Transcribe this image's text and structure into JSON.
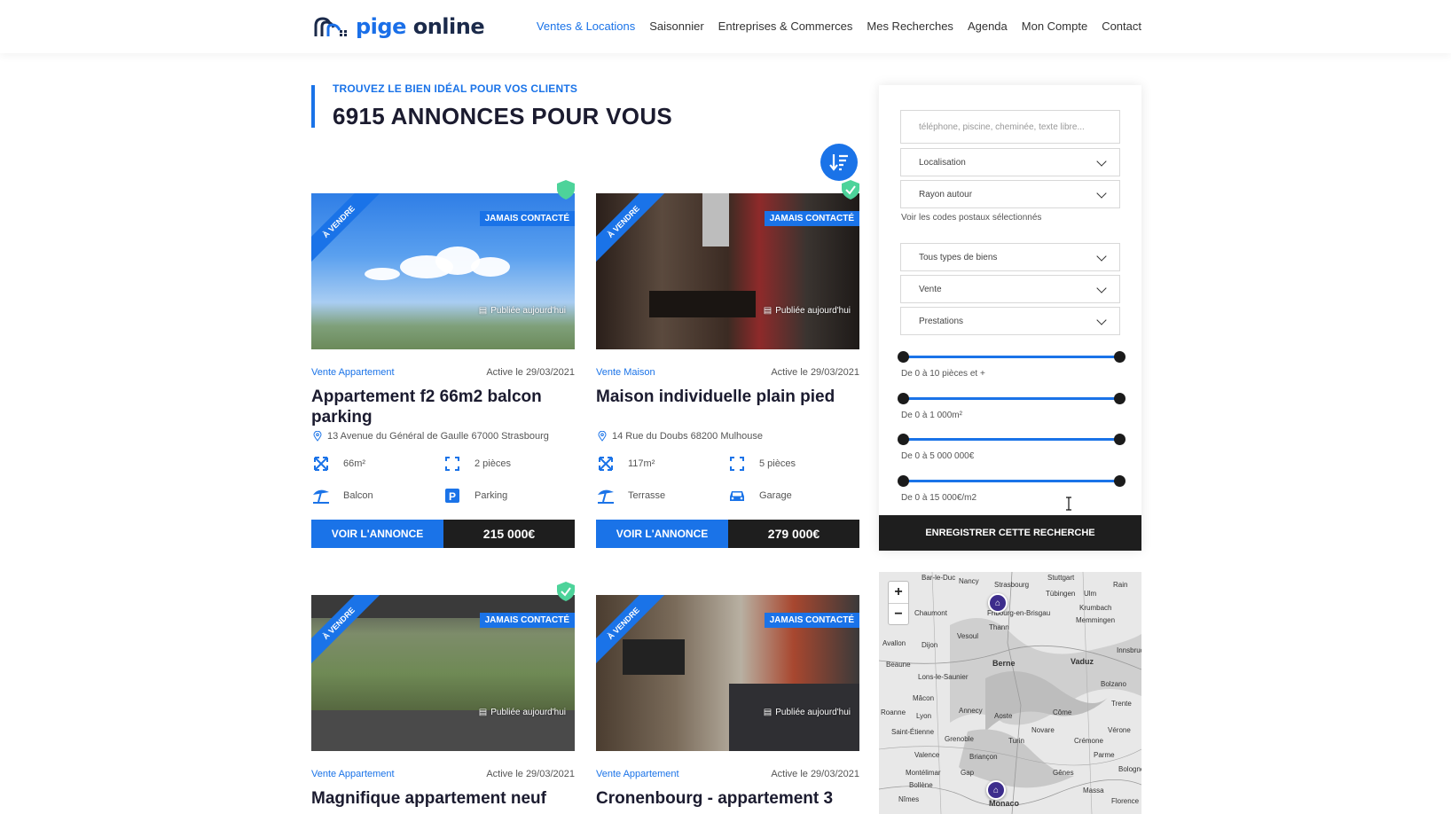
{
  "brand": {
    "part1": "pige",
    "part2": " online"
  },
  "nav": [
    "Ventes & Locations",
    "Saisonnier",
    "Entreprises & Commerces",
    "Mes Recherches",
    "Agenda",
    "Mon Compte",
    "Contact"
  ],
  "hero": {
    "subtitle": "TROUVEZ LE BIEN IDÉAL POUR VOS CLIENTS",
    "title": "6915 ANNONCES POUR VOUS"
  },
  "cards": [
    {
      "ribbon": "À VENDRE",
      "badge": "JAMAIS CONTACTÉ",
      "published": "Publiée aujourd'hui",
      "type": "Vente Appartement",
      "date": "Active le 29/03/2021",
      "title": "Appartement f2 66m2 balcon parking",
      "address": "13 Avenue du Général de Gaulle 67000 Strasbourg",
      "f1": "66m²",
      "f2": "2 pièces",
      "f3": "Balcon",
      "f4": "Parking",
      "cta": "VOIR L'ANNONCE",
      "price": "215 000€"
    },
    {
      "ribbon": "À VENDRE",
      "badge": "JAMAIS CONTACTÉ",
      "published": "Publiée aujourd'hui",
      "type": "Vente Maison",
      "date": "Active le 29/03/2021",
      "title": "Maison individuelle plain pied",
      "address": "14 Rue du Doubs 68200 Mulhouse",
      "f1": "117m²",
      "f2": "5 pièces",
      "f3": "Terrasse",
      "f4": "Garage",
      "cta": "VOIR L'ANNONCE",
      "price": "279 000€"
    },
    {
      "ribbon": "À VENDRE",
      "badge": "JAMAIS CONTACTÉ",
      "published": "Publiée aujourd'hui",
      "type": "Vente Appartement",
      "date": "Active le 29/03/2021",
      "title": "Magnifique appartement neuf"
    },
    {
      "ribbon": "À VENDRE",
      "badge": "JAMAIS CONTACTÉ",
      "published": "Publiée aujourd'hui",
      "type": "Vente Appartement",
      "date": "Active le 29/03/2021",
      "title": "Cronenbourg - appartement 3"
    }
  ],
  "sidebar": {
    "search_placeholder": "téléphone, piscine, cheminée, texte libre...",
    "localisation": "Localisation",
    "rayon": "Rayon autour",
    "codes_link": "Voir les codes postaux sélectionnés",
    "types": "Tous types de biens",
    "transaction": "Vente",
    "prestations": "Prestations",
    "ranges": [
      "De 0 à 10 pièces et +",
      "De 0 à 1 000m²",
      "De 0 à 5 000 000€",
      "De 0 à 15 000€/m2"
    ],
    "save": "ENREGISTRER CETTE RECHERCHE"
  },
  "map": {
    "zoom_in": "+",
    "zoom_out": "−",
    "cities": [
      "Bar-le-Duc",
      "Nancy",
      "Strasbourg",
      "Stuttgart",
      "Tübingen",
      "Ulm",
      "Rain",
      "Chaumont",
      "Fribourg-en-Brisgau",
      "Krumbach",
      "Memmingen",
      "Vesoul",
      "Avallon",
      "Dijon",
      "Thann",
      "Beaune",
      "Berne",
      "Vaduz",
      "Lons-le-Saunier",
      "Bolzano",
      "Mâcon",
      "Annecy",
      "Trente",
      "Lyon",
      "Aoste",
      "Côme",
      "Roanne",
      "Grenoble",
      "Novare",
      "Vérone",
      "Valence",
      "Turin",
      "Crémone",
      "Briançon",
      "Parme",
      "Montélimar",
      "Gap",
      "Gênes",
      "Bologne",
      "Bollène",
      "Massa",
      "Nîmes",
      "Monaco",
      "Florence",
      "Saint-Étienne",
      "Innsbruck"
    ]
  }
}
